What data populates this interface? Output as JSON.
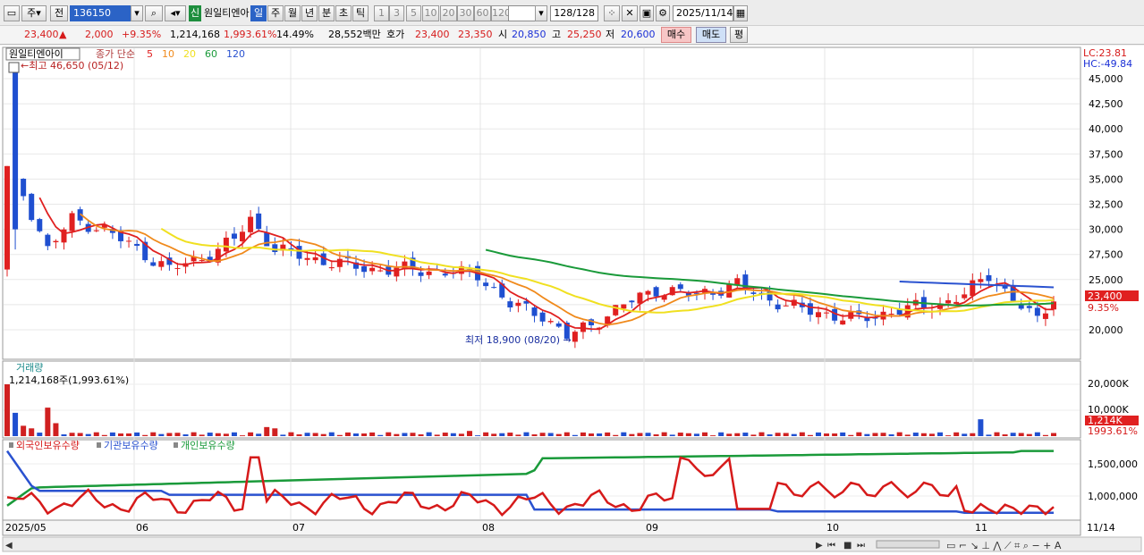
{
  "toolbar": {
    "period_select": "주",
    "prev_label": "전",
    "code": "136150",
    "stock_badge": "신",
    "stock_name": "원일티엔아",
    "tabs": [
      {
        "label": "일",
        "selected": true
      },
      {
        "label": "주",
        "selected": false
      },
      {
        "label": "월",
        "selected": false
      },
      {
        "label": "년",
        "selected": false
      },
      {
        "label": "분",
        "selected": false
      },
      {
        "label": "초",
        "selected": false
      },
      {
        "label": "틱",
        "selected": false
      }
    ],
    "intervals": [
      "1",
      "3",
      "5",
      "10",
      "20",
      "30",
      "60",
      "120"
    ],
    "count": "128",
    "count_total": "/128",
    "date": "2025/11/14"
  },
  "quote": {
    "price": "23,400",
    "change_arrow": "▲",
    "change": "2,000",
    "change_pct": "+9.35%",
    "volume": "1,214,168",
    "volume_pct": "1,993.61%",
    "turnover": "14.49%",
    "amount": "28,552백만",
    "bid_label": "호가",
    "ask": "23,400",
    "bid": "23,350",
    "open_label": "시",
    "open": "20,850",
    "high_label": "고",
    "high": "25,250",
    "low_label": "저",
    "low": "20,600",
    "buy_button": "매수",
    "sell_button": "매도",
    "eval_button": "평"
  },
  "price_panel": {
    "name_label": "원일티엔아이",
    "legend_prefix": "종가 단순",
    "ma_legend": [
      {
        "label": "5",
        "color": "#e02020"
      },
      {
        "label": "10",
        "color": "#f08a1c"
      },
      {
        "label": "20",
        "color": "#f0e020"
      },
      {
        "label": "60",
        "color": "#1a9a3a"
      },
      {
        "label": "120",
        "color": "#2a52d0"
      }
    ],
    "high_note": "←최고 46,650 (05/12)",
    "low_note": "최저 18,900 (08/20) →",
    "lc_label": "LC:23.81",
    "hc_label": "HC:-49.84",
    "current_tag": "23,400",
    "current_pct_tag": "9.35%",
    "y_labels": [
      "45,000",
      "42,500",
      "40,000",
      "37,500",
      "35,000",
      "32,500",
      "30,000",
      "27,500",
      "25,000",
      "20,000"
    ]
  },
  "volume_panel": {
    "title": "거래량",
    "value_note": "1,214,168주(1,993.61%)",
    "y_labels": [
      "20,000K",
      "10,000K"
    ],
    "current_tag": "1,214K",
    "current_pct_tag": "1993.61%"
  },
  "holding_panel": {
    "legend": [
      {
        "label": "외국인보유수량",
        "color": "#d61a1a"
      },
      {
        "label": "기관보유수량",
        "color": "#2a52d0"
      },
      {
        "label": "개인보유수량",
        "color": "#1a9a3a"
      }
    ],
    "y_labels": [
      "1,500,000",
      "1,000,000"
    ]
  },
  "x_axis": {
    "labels": [
      "2025/05",
      "06",
      "07",
      "08",
      "09",
      "10",
      "11"
    ],
    "end_label": "11/14"
  },
  "colors": {
    "up": "#e02020",
    "down": "#1f4fd0",
    "grid": "#e4e4e4"
  },
  "chart_data": {
    "type": "candlestick",
    "date_range": [
      "2025/05",
      "2025/11/14"
    ],
    "price_axis": [
      20000,
      45000
    ],
    "candles_sample": [
      {
        "x": "2025/05",
        "open": 26000,
        "close": 36000,
        "high": 37500,
        "low": 25500
      },
      {
        "x": "05/12",
        "open": 30000,
        "close": 46000,
        "high": 46650,
        "low": 29000
      },
      {
        "x": "08/20",
        "open": 19500,
        "close": 19300,
        "high": 19800,
        "low": 18900
      },
      {
        "x": "11/14",
        "open": 20850,
        "close": 23400,
        "high": 25250,
        "low": 20600
      }
    ]
  }
}
